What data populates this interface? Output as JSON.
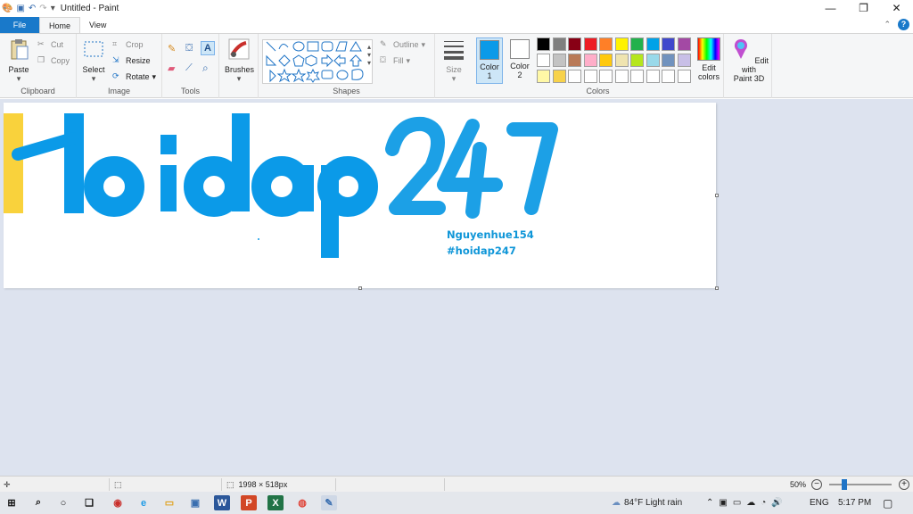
{
  "window": {
    "title": "Untitled - Paint",
    "controls": {
      "minimize": "—",
      "maximize": "❐",
      "close": "✕"
    }
  },
  "tabs": [
    {
      "label": "File"
    },
    {
      "label": "Home"
    },
    {
      "label": "View"
    }
  ],
  "ribbon": {
    "clipboard": {
      "label": "Clipboard",
      "paste": "Paste",
      "cut": "Cut",
      "copy": "Copy"
    },
    "image": {
      "label": "Image",
      "select": "Select",
      "crop": "Crop",
      "resize": "Resize",
      "rotate": "Rotate"
    },
    "tools": {
      "label": "Tools"
    },
    "brushes": {
      "label": "Brushes"
    },
    "shapes": {
      "label": "Shapes",
      "outline": "Outline",
      "fill": "Fill"
    },
    "size": {
      "label": "Size"
    },
    "colors": {
      "label": "Colors",
      "color1_label": "Color",
      "color1_num": "1",
      "color2_label": "Color",
      "color2_num": "2",
      "color1_value": "#0b9ae8",
      "color2_value": "#ffffff",
      "edit_colors_1": "Edit",
      "edit_colors_2": "colors",
      "edit_paint3d_1": "Edit with",
      "edit_paint3d_2": "Paint 3D",
      "palette_row1": [
        "#000000",
        "#7f7f7f",
        "#880015",
        "#ed1c24",
        "#ff7f27",
        "#fff200",
        "#22b14c",
        "#00a2e8",
        "#3f48cc",
        "#a349a4"
      ],
      "palette_row2": [
        "#ffffff",
        "#c3c3c3",
        "#b97a57",
        "#ffaec9",
        "#ffc90e",
        "#efe4b0",
        "#b5e61d",
        "#99d9ea",
        "#7092be",
        "#c8bfe7"
      ],
      "palette_row3": [
        "#fff8a6",
        "#f7d24b",
        "#ffffff",
        "#ffffff",
        "#ffffff",
        "#ffffff",
        "#ffffff",
        "#ffffff",
        "#ffffff",
        "#ffffff"
      ]
    }
  },
  "canvas": {
    "main_text": "Hoidap247",
    "line1": "Nguyenhue154",
    "line2": "#hoidap247",
    "ink_color": "#0b9ae8",
    "accent_color": "#f9d23c"
  },
  "statusbar": {
    "dimensions": "1998 × 518px",
    "zoom": "50%",
    "zoom_minus": "−",
    "zoom_plus": "+"
  },
  "taskbar": {
    "weather": "84°F  Light rain",
    "language": "ENG",
    "time": "5:17 PM",
    "apps": [
      {
        "name": "start",
        "glyph": "⊞"
      },
      {
        "name": "search",
        "glyph": "⌕"
      },
      {
        "name": "cortana",
        "glyph": "○"
      },
      {
        "name": "task-view",
        "glyph": "❏"
      },
      {
        "name": "app-red",
        "glyph": "◉"
      },
      {
        "name": "edge",
        "glyph": "e"
      },
      {
        "name": "file-explorer",
        "glyph": "▭"
      },
      {
        "name": "computer",
        "glyph": "▣"
      },
      {
        "name": "word",
        "glyph": "W"
      },
      {
        "name": "powerpoint",
        "glyph": "P"
      },
      {
        "name": "excel",
        "glyph": "X"
      },
      {
        "name": "chrome",
        "glyph": "◍"
      },
      {
        "name": "paint",
        "glyph": "✎"
      }
    ]
  }
}
